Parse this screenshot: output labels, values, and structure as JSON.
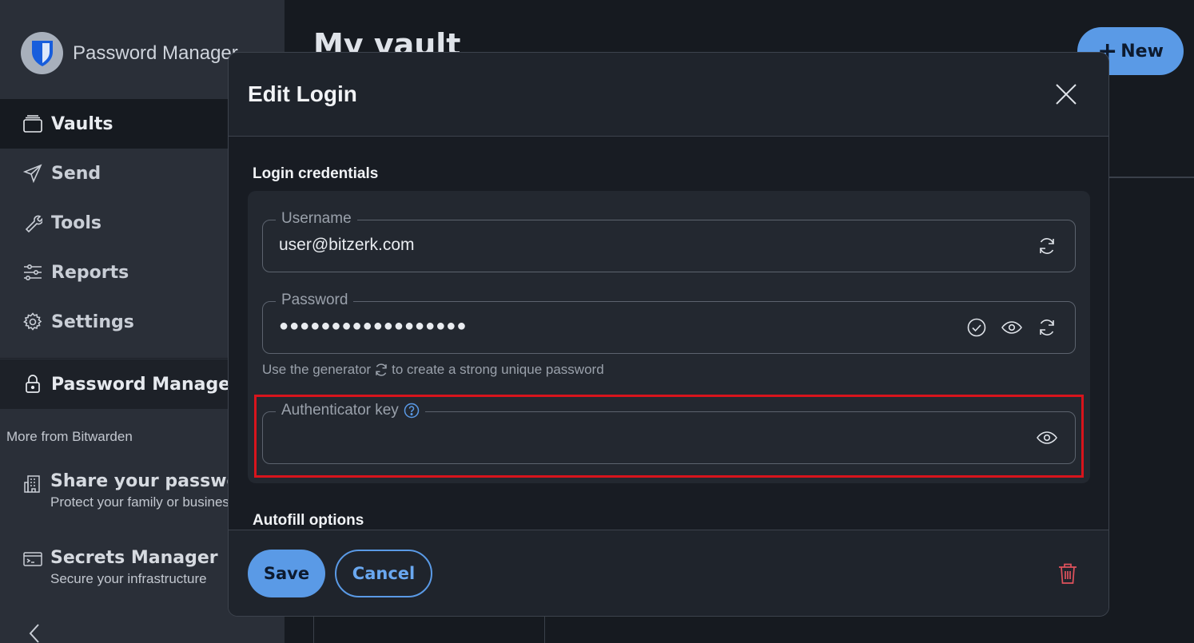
{
  "app": {
    "brand": "Password Manager"
  },
  "sidebar": {
    "items": [
      {
        "label": "Vaults",
        "icon": "vault-icon"
      },
      {
        "label": "Send",
        "icon": "send-icon"
      },
      {
        "label": "Tools",
        "icon": "wrench-icon"
      },
      {
        "label": "Reports",
        "icon": "sliders-icon"
      },
      {
        "label": "Settings",
        "icon": "gear-icon"
      }
    ],
    "product_switcher": {
      "label": "Password Manager",
      "icon": "lock-icon"
    },
    "more_from": "More from Bitwarden",
    "promos": [
      {
        "title": "Share your passwords",
        "subtitle": "Protect your family or business",
        "icon": "building-icon"
      },
      {
        "title": "Secrets Manager",
        "subtitle": "Secure your infrastructure",
        "icon": "terminal-icon"
      }
    ]
  },
  "main": {
    "title": "My vault",
    "new_button": "New"
  },
  "dialog": {
    "title": "Edit Login",
    "sections": {
      "credentials": "Login credentials",
      "autofill": "Autofill options"
    },
    "username": {
      "label": "Username",
      "value": "user@bitzerk.com"
    },
    "password": {
      "label": "Password",
      "value": "●●●●●●●●●●●●●●●●●●"
    },
    "hint": {
      "before": "Use the generator",
      "after": "to create a strong unique password"
    },
    "authenticator": {
      "label": "Authenticator key",
      "value": ""
    },
    "footer": {
      "save": "Save",
      "cancel": "Cancel"
    }
  },
  "colors": {
    "accent": "#5a9ae6",
    "danger": "#e0525c",
    "highlight": "#d8141c"
  }
}
